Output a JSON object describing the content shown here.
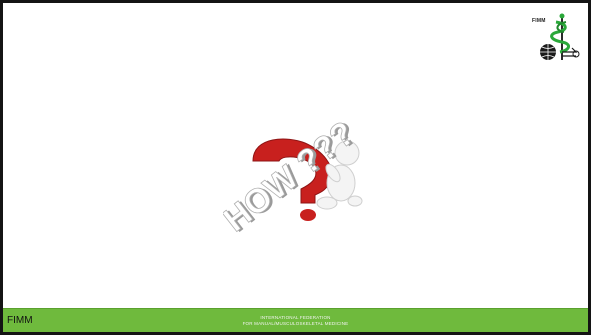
{
  "logo": {
    "text": "FIMM",
    "icon": "caduceus-globe-icon"
  },
  "illustration": {
    "text": "HOW ???",
    "icon": "question-mark-figure-icon",
    "colors": {
      "question_mark": "#c8201e",
      "figure": "#f2f2f2",
      "text_fill": "#ffffff",
      "text_shadow": "#9a9a9a"
    }
  },
  "footer": {
    "left_text": "FIMM",
    "center_line1": "INTERNATIONAL  FEDERATION",
    "center_line2": "FOR MANUAL/MUSCULOSKELETAL MEDICINE",
    "color": "#6fba3d"
  }
}
